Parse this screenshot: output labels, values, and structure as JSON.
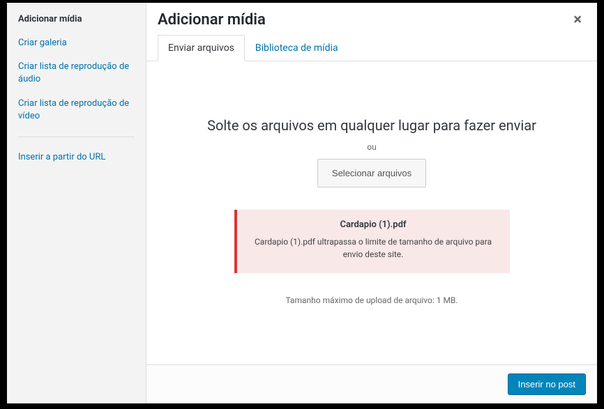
{
  "sidebar": {
    "title": "Adicionar mídia",
    "items": [
      {
        "label": "Criar galeria"
      },
      {
        "label": "Criar lista de reprodução de áudio"
      },
      {
        "label": "Criar lista de reprodução de vídeo"
      }
    ],
    "url_item": {
      "label": "Inserir a partir do URL"
    }
  },
  "header": {
    "title": "Adicionar mídia",
    "close": "×"
  },
  "tabs": {
    "upload": "Enviar arquivos",
    "library": "Biblioteca de mídia"
  },
  "upload": {
    "drop_text": "Solte os arquivos em qualquer lugar para fazer enviar",
    "or_text": "ou",
    "select_btn": "Selecionar arquivos",
    "max_size": "Tamanho máximo de upload de arquivo: 1 MB."
  },
  "error": {
    "filename": "Cardapio (1).pdf",
    "message": "Cardapio (1).pdf ultrapassa o limite de tamanho de arquivo para envio deste site."
  },
  "footer": {
    "insert_btn": "Inserir no post"
  }
}
